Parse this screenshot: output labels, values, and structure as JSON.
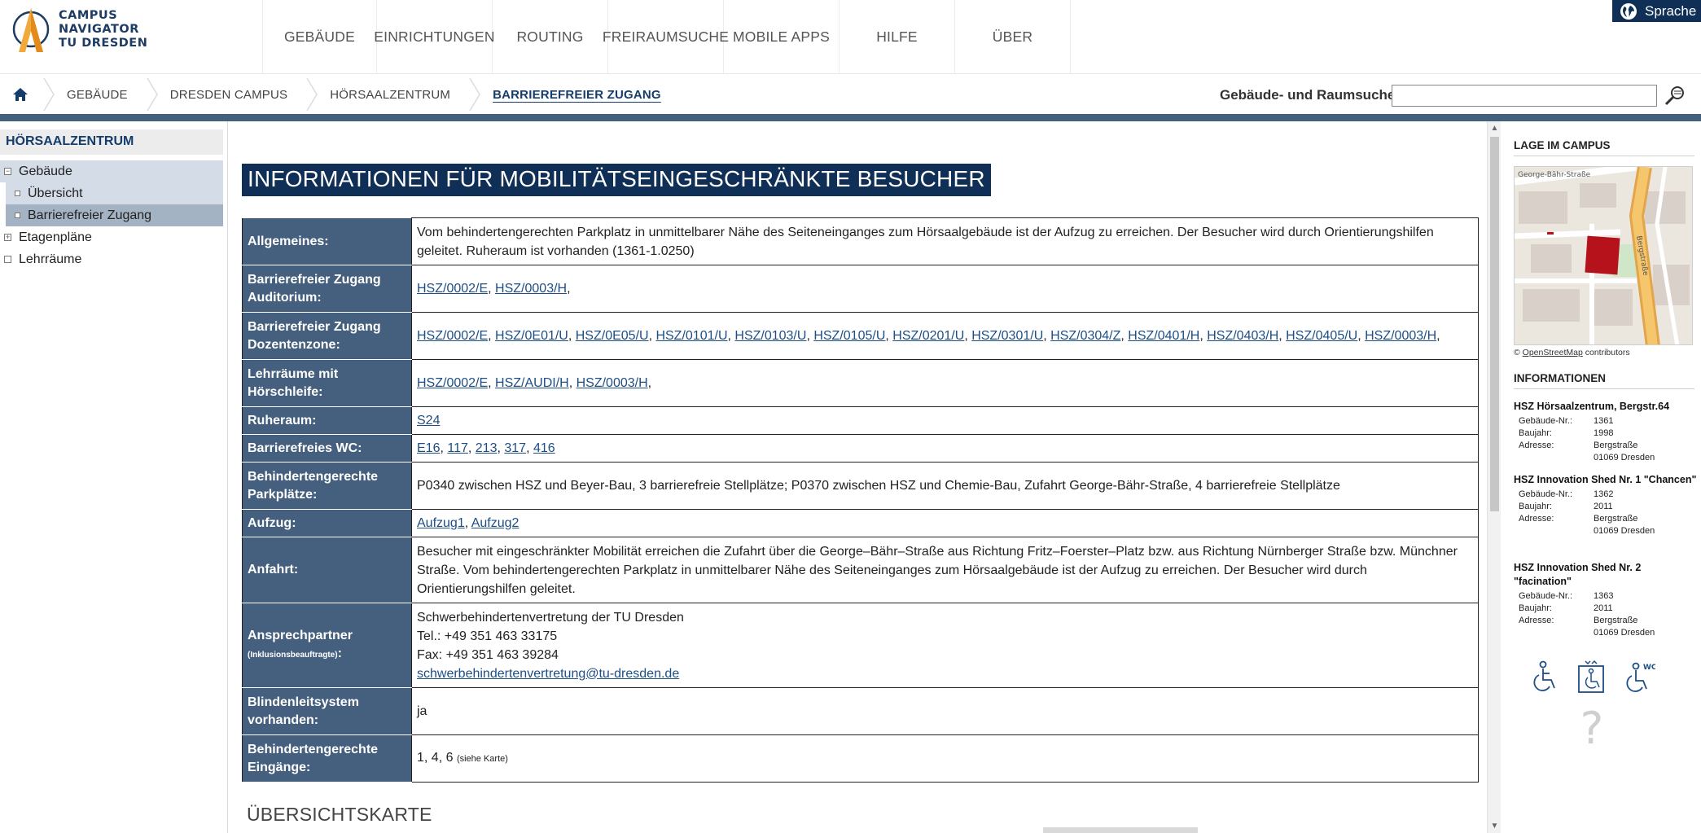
{
  "header": {
    "logo_lines": [
      "CAMPUS",
      "NAVIGATOR",
      "TU DRESDEN"
    ],
    "nav": [
      "GEBÄUDE",
      "EINRICHTUNGEN",
      "ROUTING",
      "FREIRAUMSUCHE",
      "MOBILE APPS",
      "HILFE",
      "ÜBER"
    ],
    "language_label": "Sprache"
  },
  "breadcrumb": [
    "GEBÄUDE",
    "DRESDEN CAMPUS",
    "HÖRSAALZENTRUM",
    "BARRIEREFREIER ZUGANG"
  ],
  "search": {
    "label": "Gebäude- und Raumsuche",
    "value": ""
  },
  "sidebar": {
    "title": "HÖRSAALZENTRUM",
    "tree": [
      {
        "label": "Gebäude",
        "marker": "−"
      },
      {
        "label": "Übersicht",
        "marker": ""
      },
      {
        "label": "Barrierefreier Zugang",
        "marker": ""
      },
      {
        "label": "Etagenpläne",
        "marker": "+"
      },
      {
        "label": "Lehrräume",
        "marker": ""
      }
    ]
  },
  "main": {
    "title": "INFORMATIONEN FÜR MOBILITÄTSEINGESCHRÄNKTE BESUCHER",
    "rows": {
      "allgemeines": {
        "key": "Allgemeines:",
        "text": "Vom behindertengerechten Parkplatz in unmittelbarer Nähe des Seiteneinganges zum Hörsaalgebäude ist der Aufzug zu erreichen. Der Besucher wird durch Orientierungshilfen geleitet. Ruheraum ist vorhanden (1361-1.0250)"
      },
      "auditorium": {
        "key": "Barrierefreier Zugang Auditorium:",
        "links": [
          "HSZ/0002/E",
          "HSZ/0003/H"
        ]
      },
      "dozentenzone": {
        "key": "Barrierefreier Zugang Dozentenzone:",
        "links": [
          "HSZ/0002/E",
          "HSZ/0E01/U",
          "HSZ/0E05/U",
          "HSZ/0101/U",
          "HSZ/0103/U",
          "HSZ/0105/U",
          "HSZ/0201/U",
          "HSZ/0301/U",
          "HSZ/0304/Z",
          "HSZ/0401/H",
          "HSZ/0403/H",
          "HSZ/0405/U",
          "HSZ/0003/H"
        ]
      },
      "hoerschleife": {
        "key": "Lehrräume mit Hörschleife:",
        "links": [
          "HSZ/0002/E",
          "HSZ/AUDI/H",
          "HSZ/0003/H"
        ]
      },
      "ruheraum": {
        "key": "Ruheraum:",
        "links": [
          "S24"
        ]
      },
      "wc": {
        "key": "Barrierefreies WC:",
        "links": [
          "E16",
          "117",
          "213",
          "317",
          "416"
        ]
      },
      "parkplaetze": {
        "key": "Behindertengerechte Parkplätze:",
        "text": "P0340 zwischen HSZ und Beyer-Bau, 3 barrierefreie Stellplätze; P0370 zwischen HSZ und Chemie-Bau, Zufahrt George-Bähr-Straße, 4 barrierefreie Stellplätze"
      },
      "aufzug": {
        "key": "Aufzug:",
        "links": [
          "Aufzug1",
          "Aufzug2"
        ]
      },
      "anfahrt": {
        "key": "Anfahrt:",
        "text": "Besucher mit eingeschränkter Mobilität erreichen die Zufahrt über die George–Bähr–Straße aus Richtung Fritz–Foerster–Platz bzw. aus Richtung Nürnberger Straße bzw. Münchner Straße. Vom behindertengerechten Parkplatz in unmittelbarer Nähe des Seiteneinganges zum Hörsaalgebäude ist der Aufzug zu erreichen. Der Besucher wird durch Orientierungshilfen geleitet."
      },
      "ansprechpartner": {
        "key": "Ansprechpartner",
        "key_small": "(Inklusionsbeauftragte)",
        "key_colon": ":",
        "name": "Schwerbehindertenvertretung der TU Dresden",
        "tel": "Tel.: +49 351 463 33175",
        "fax": "Fax: +49 351 463 39284",
        "email": "schwerbehindertenvertretung@tu-dresden.de"
      },
      "blindenleit": {
        "key": "Blindenleitsystem vorhanden:",
        "text": "ja"
      },
      "eingaenge": {
        "key": "Behindertengerechte Eingänge:",
        "text": "1, 4, 6",
        "note": "(siehe Karte)"
      }
    },
    "section_title": "ÜBERSICHTSKARTE"
  },
  "right": {
    "lage_title": "LAGE IM CAMPUS",
    "map_labels": {
      "street1": "George-Bähr-Straße",
      "street2": "Bergstraße"
    },
    "osm_prefix": "©",
    "osm_link": "OpenStreetMap",
    "osm_suffix": "contributors",
    "info_title": "INFORMATIONEN",
    "field_labels": {
      "nr": "Gebäude-Nr.:",
      "year": "Baujahr:",
      "addr": "Adresse:"
    },
    "buildings": [
      {
        "title": "HSZ Hörsaalzentrum, Bergstr.64",
        "nr": "1361",
        "year": "1998",
        "street": "Bergstraße",
        "city": "01069 Dresden"
      },
      {
        "title": "HSZ Innovation Shed Nr. 1 \"Chancen\"",
        "nr": "1362",
        "year": "2011",
        "street": "Bergstraße",
        "city": "01069 Dresden"
      },
      {
        "title": "HSZ Innovation Shed Nr. 2 \"facination\"",
        "nr": "1363",
        "year": "2011",
        "street": "Bergstraße",
        "city": "01069 Dresden"
      }
    ],
    "wc_mark": "WC",
    "help_mark": "?"
  },
  "colors": {
    "navy": "#0f2f56",
    "slate": "#45607e",
    "link": "#1d4e85",
    "building": "#b5121b"
  }
}
